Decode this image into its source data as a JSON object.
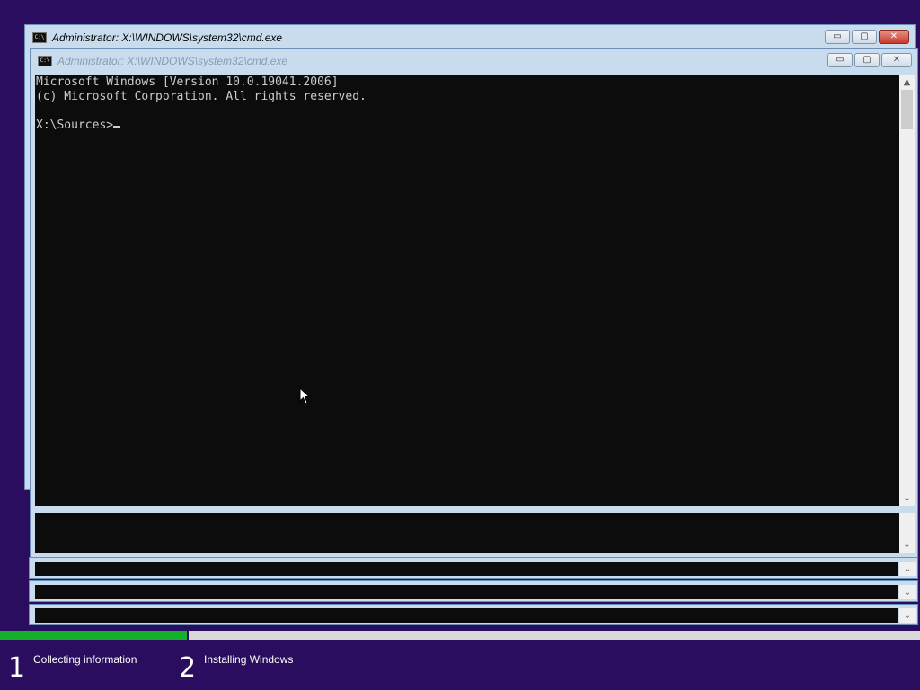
{
  "windows": [
    {
      "title": "Administrator: X:\\WINDOWS\\system32\\cmd.exe",
      "state": "active",
      "controls": {
        "minimize": "▭",
        "maximize": "▢",
        "close": "✕"
      }
    },
    {
      "title": "Administrator: X:\\WINDOWS\\system32\\cmd.exe",
      "state": "inactive",
      "controls": {
        "minimize": "▭",
        "maximize": "▢",
        "close": "✕"
      }
    }
  ],
  "icons": {
    "cmd": "cmd-icon",
    "scroll_up": "▲",
    "scroll_down": "▼",
    "chevron": "⌄"
  },
  "console": {
    "lines": [
      "Microsoft Windows [Version 10.0.19041.2006]",
      "(c) Microsoft Corporation. All rights reserved.",
      "",
      "X:\\Sources>"
    ]
  },
  "setup": {
    "progress_fraction": 0.205,
    "steps": [
      {
        "number": "1",
        "label": "Collecting information"
      },
      {
        "number": "2",
        "label": "Installing Windows"
      }
    ]
  },
  "colors": {
    "desktop": "#2a0d5e",
    "progress": "#14b02c",
    "console_bg": "#0c0c0c",
    "console_fg": "#cccccc"
  }
}
